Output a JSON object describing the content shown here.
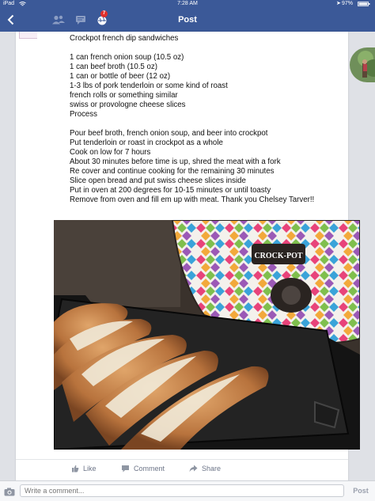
{
  "status_bar": {
    "carrier": "iPad",
    "time": "7:28 AM",
    "battery": "97%"
  },
  "nav": {
    "title": "Post",
    "notification_count": "7"
  },
  "post": {
    "title": "Crockpot french dip sandwiches",
    "ingredients": [
      "1 can french onion soup (10.5 oz)",
      "1 can beef broth (10.5 oz)",
      "1 can or bottle of beer (12 oz)",
      "1-3 lbs of pork tenderloin or some kind of roast",
      "french rolls or something similar",
      "swiss or provologne cheese slices",
      "Process"
    ],
    "steps": [
      "Pour beef broth, french onion soup, and beer into crockpot",
      "Put tenderloin or roast in crockpot as a whole",
      "Cook on low for 7 hours",
      "About 30 minutes before time is up, shred the meat with a fork",
      "Re cover and continue cooking for the remaining 30 minutes",
      "Slice open bread and put swiss cheese slices inside",
      "Put in oven at 200 degrees for 10-15 minutes or until toasty",
      "Remove from oven and fill em up with meat. Thank you Chelsey Tarver!!"
    ],
    "photo_brand": "CROCK-POT"
  },
  "actions": {
    "like": "Like",
    "comment": "Comment",
    "share": "Share"
  },
  "comment_bar": {
    "placeholder": "Write a comment...",
    "post_label": "Post"
  }
}
